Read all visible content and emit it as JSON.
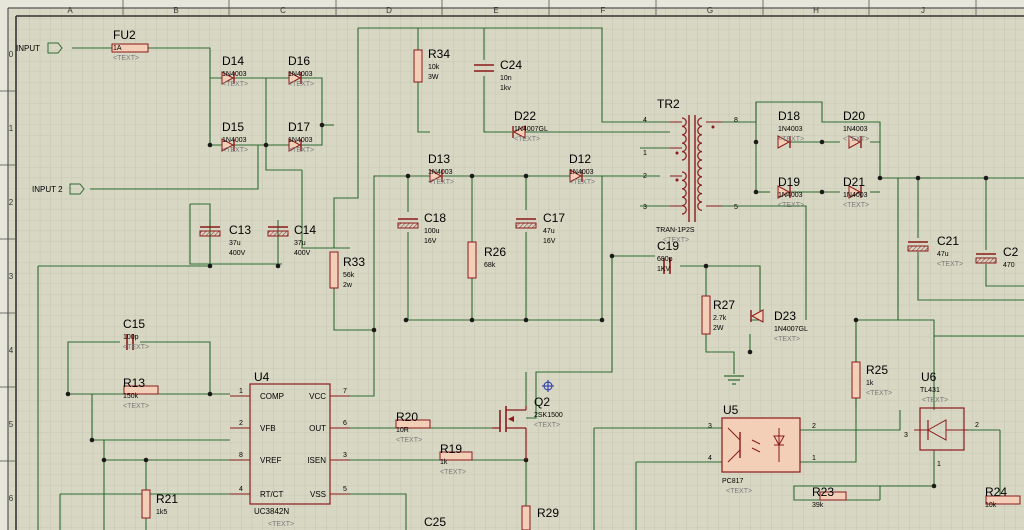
{
  "colors": {
    "background": "#d7d7c4",
    "grid": "#b8b8a6",
    "wire": "#2f6b2f",
    "body": "#8b1a1a",
    "fill": "#f2cfb6",
    "hatch": "#b05050",
    "label": "#000000",
    "text": "#7a7a7a",
    "border": "#555555"
  },
  "column_labels": [
    "A",
    "B",
    "C",
    "D",
    "E",
    "F",
    "G",
    "H",
    "J"
  ],
  "row_labels": [
    "0",
    "1",
    "2",
    "3",
    "4",
    "5",
    "6"
  ],
  "ports": {
    "input1": "INPUT",
    "input2": "INPUT 2"
  },
  "placeholder": "<TEXT>",
  "components": {
    "fu2": {
      "ref": "FU2",
      "value": "1A"
    },
    "d14": {
      "ref": "D14",
      "value": "1N4003"
    },
    "d16": {
      "ref": "D16",
      "value": "1N4003"
    },
    "d15": {
      "ref": "D15",
      "value": "1N4003"
    },
    "d17": {
      "ref": "D17",
      "value": "1N4003"
    },
    "c13": {
      "ref": "C13",
      "value": "37u",
      "value2": "400V"
    },
    "c14": {
      "ref": "C14",
      "value": "37u",
      "value2": "400V"
    },
    "r34": {
      "ref": "R34",
      "value": "10k",
      "value2": "3W"
    },
    "c24": {
      "ref": "C24",
      "value": "10n",
      "value2": "1kv"
    },
    "d22": {
      "ref": "D22",
      "value": "1N4007GL"
    },
    "d13": {
      "ref": "D13",
      "value": "1N4003"
    },
    "d12": {
      "ref": "D12",
      "value": "1N4003"
    },
    "c18": {
      "ref": "C18",
      "value": "100u",
      "value2": "16V"
    },
    "c17": {
      "ref": "C17",
      "value": "47u",
      "value2": "16V"
    },
    "r26": {
      "ref": "R26",
      "value": "68k"
    },
    "r33": {
      "ref": "R33",
      "value": "56k",
      "value2": "2w"
    },
    "tr2": {
      "ref": "TR2",
      "value": "TRAN-1P2S",
      "pins": [
        "4",
        "1",
        "2",
        "3",
        "8",
        "5"
      ]
    },
    "d18": {
      "ref": "D18",
      "value": "1N4003"
    },
    "d20": {
      "ref": "D20",
      "value": "1N4003"
    },
    "d19": {
      "ref": "D19",
      "value": "1N4003"
    },
    "d21": {
      "ref": "D21",
      "value": "1N4003"
    },
    "c19": {
      "ref": "C19",
      "value": "680p",
      "value2": "1KV"
    },
    "r27": {
      "ref": "R27",
      "value": "2.7k",
      "value2": "2W"
    },
    "d23": {
      "ref": "D23",
      "value": "1N4007GL"
    },
    "c21": {
      "ref": "C21",
      "value": "47u"
    },
    "c2x": {
      "ref": "C2",
      "value": "470"
    },
    "c15": {
      "ref": "C15",
      "value": "100p"
    },
    "r13": {
      "ref": "R13",
      "value": "150k"
    },
    "u4": {
      "ref": "U4",
      "value": "UC3842N",
      "left_pins": [
        [
          "1",
          "COMP"
        ],
        [
          "2",
          "VFB"
        ],
        [
          "8",
          "VREF"
        ],
        [
          "4",
          "RT/CT"
        ]
      ],
      "right_pins": [
        [
          "7",
          "VCC"
        ],
        [
          "6",
          "OUT"
        ],
        [
          "3",
          "ISEN"
        ],
        [
          "5",
          "VSS"
        ]
      ]
    },
    "r20": {
      "ref": "R20",
      "value": "10R"
    },
    "r19": {
      "ref": "R19",
      "value": "1k"
    },
    "q2": {
      "ref": "Q2",
      "value": "2SK1500"
    },
    "r21": {
      "ref": "R21",
      "value": "1k5"
    },
    "c25": {
      "ref": "C25"
    },
    "r29": {
      "ref": "R29"
    },
    "u5": {
      "ref": "U5",
      "value": "PC817",
      "pins": [
        "3",
        "4",
        "2",
        "1"
      ]
    },
    "r25": {
      "ref": "R25",
      "value": "1k"
    },
    "u6": {
      "ref": "U6",
      "value": "TL431",
      "pins": [
        "3",
        "2",
        "1"
      ]
    },
    "r23": {
      "ref": "R23",
      "value": "39k"
    },
    "r24": {
      "ref": "R24",
      "value": "10k"
    }
  }
}
